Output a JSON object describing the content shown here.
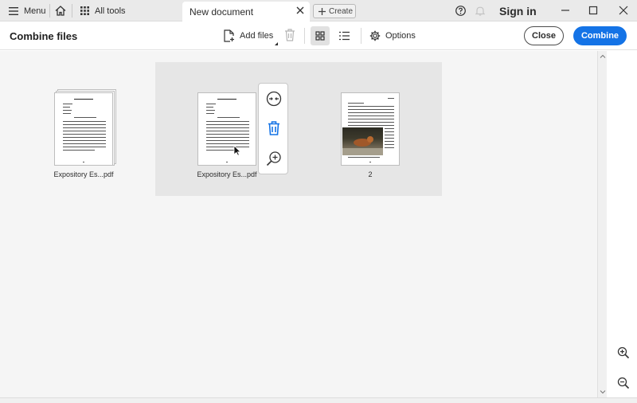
{
  "titlebar": {
    "menu_label": "Menu",
    "all_tools_label": "All tools",
    "tab_title": "New document",
    "create_label": "Create",
    "sign_in_label": "Sign in"
  },
  "toolbar": {
    "title": "Combine files",
    "add_files_label": "Add files",
    "options_label": "Options",
    "close_label": "Close",
    "combine_label": "Combine"
  },
  "files": [
    {
      "label": "Expository Es...pdf",
      "stacked": true
    },
    {
      "label": "Expository Es...pdf",
      "stacked": false,
      "selected": true
    },
    {
      "label": "2",
      "stacked": false,
      "has_image": true
    }
  ],
  "colors": {
    "accent": "#1473e6",
    "selection_bg": "#e6e6e6",
    "workspace_bg": "#f5f5f5"
  },
  "icons": [
    "menu-icon",
    "home-icon",
    "grid-icon",
    "close-icon",
    "plus-icon",
    "help-icon",
    "bell-icon",
    "minimize-icon",
    "maximize-icon",
    "add-file-icon",
    "trash-icon",
    "grid-view-icon",
    "list-view-icon",
    "gear-icon",
    "expand-icon",
    "delete-icon",
    "zoom-in-icon",
    "zoom-out-icon"
  ]
}
